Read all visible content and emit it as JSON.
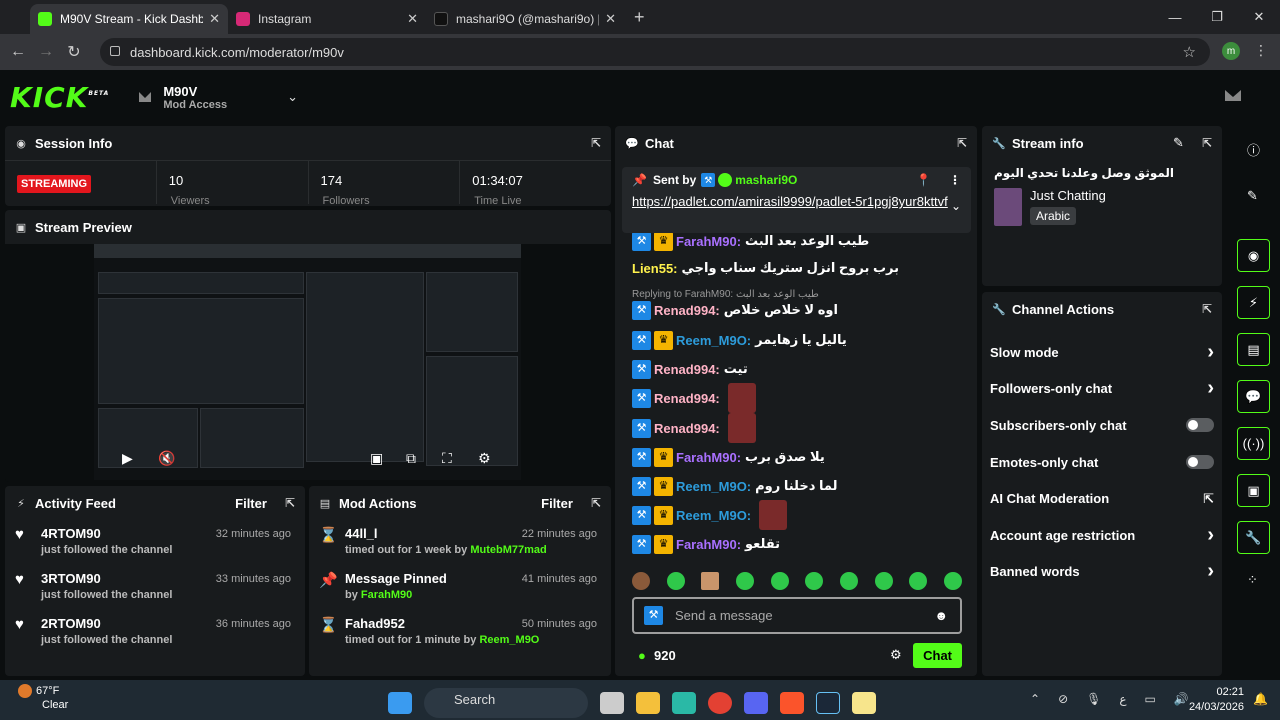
{
  "browser": {
    "tabs": [
      {
        "title": "M90V Stream - Kick Dashboard",
        "color": "#53fc18"
      },
      {
        "title": "Instagram",
        "color": "#d62976"
      },
      {
        "title": "mashari9O (@mashari9o) | TikT",
        "color": "#000000"
      }
    ],
    "url": "dashboard.kick.com/moderator/m90v",
    "profile_initial": "m"
  },
  "header": {
    "logo": "KICK",
    "beta": "BETA",
    "channel_name": "M90V",
    "channel_role": "Mod Access"
  },
  "session": {
    "title": "Session Info",
    "status": "STREAMING",
    "viewers": "10",
    "viewers_label": "Viewers",
    "followers": "174",
    "followers_label": "Followers",
    "time": "01:34:07",
    "time_label": "Time Live"
  },
  "preview": {
    "title": "Stream Preview"
  },
  "activity": {
    "title": "Activity Feed",
    "filter": "Filter",
    "items": [
      {
        "name": "4RTOM90",
        "sub": "just followed the channel",
        "time": "32 minutes ago"
      },
      {
        "name": "3RTOM90",
        "sub": "just followed the channel",
        "time": "33 minutes ago"
      },
      {
        "name": "2RTOM90",
        "sub": "just followed the channel",
        "time": "36 minutes ago"
      }
    ]
  },
  "modactions": {
    "title": "Mod Actions",
    "filter": "Filter",
    "items": [
      {
        "name": "44ll_l",
        "sub": "timed out for 1 week by ",
        "by": "MutebM77mad",
        "time": "22 minutes ago",
        "icon": "hourglass"
      },
      {
        "name": "Message Pinned",
        "sub": "by ",
        "by": "FarahM90",
        "time": "41 minutes ago",
        "icon": "pin"
      },
      {
        "name": "Fahad952",
        "sub": "timed out for 1 minute by ",
        "by": "Reem_M9O",
        "time": "50 minutes ago",
        "icon": "hourglass"
      }
    ]
  },
  "chat": {
    "title": "Chat",
    "pinned_by_label": "Sent by",
    "pinned_by": "mashari9O",
    "pinned_link": "https://padlet.com/amirasil9999/padlet-5r1pgj8yur8kttvf",
    "reply_label": "Replying to FarahM90: طيب الوعد بعد البث",
    "messages": [
      {
        "user": "FarahM90:",
        "color": "#a970ff",
        "text": "طيب الوعد بعد البث",
        "mod": true,
        "crown": true
      },
      {
        "user": "Lien55:",
        "color": "#fff24d",
        "text": "برب بروح انزل ستريك سناب واجي",
        "mod": false,
        "crown": false
      },
      {
        "user": "Renad994:",
        "color": "#ffb3c6",
        "text": "اوه لا خلاص خلاص",
        "mod": true,
        "crown": false
      },
      {
        "user": "Reem_M9O:",
        "color": "#2d9cdb",
        "text": "ياليل يا زهايمر",
        "mod": true,
        "crown": true
      },
      {
        "user": "Renad994:",
        "color": "#ffb3c6",
        "text": "تيت",
        "mod": true,
        "crown": false
      },
      {
        "user": "Renad994:",
        "color": "#ffb3c6",
        "text": "",
        "mod": true,
        "crown": false
      },
      {
        "user": "Renad994:",
        "color": "#ffb3c6",
        "text": "",
        "mod": true,
        "crown": false
      },
      {
        "user": "FarahM90:",
        "color": "#a970ff",
        "text": "يلا صدق برب",
        "mod": true,
        "crown": true
      },
      {
        "user": "Reem_M9O:",
        "color": "#2d9cdb",
        "text": "لما دخلنا روم",
        "mod": true,
        "crown": true
      },
      {
        "user": "Reem_M9O:",
        "color": "#2d9cdb",
        "text": "",
        "mod": true,
        "crown": true
      },
      {
        "user": "FarahM90:",
        "color": "#a970ff",
        "text": "تقلعو",
        "mod": true,
        "crown": true
      }
    ],
    "input_placeholder": "Send a message",
    "points": "920",
    "send": "Chat"
  },
  "streaminfo": {
    "title": "Stream info",
    "stream_title": "الموثق وصل وعلدنا تحدي اليوم",
    "category": "Just Chatting",
    "language": "Arabic"
  },
  "channelactions": {
    "title": "Channel Actions",
    "items": [
      {
        "label": "Slow mode",
        "control": "chevron"
      },
      {
        "label": "Followers-only chat",
        "control": "chevron"
      },
      {
        "label": "Subscribers-only chat",
        "control": "toggle"
      },
      {
        "label": "Emotes-only chat",
        "control": "toggle"
      },
      {
        "label": "AI Chat Moderation",
        "control": "external"
      },
      {
        "label": "Account age restriction",
        "control": "chevron"
      },
      {
        "label": "Banned words",
        "control": "chevron"
      }
    ]
  },
  "taskbar": {
    "temp": "67°F",
    "weather": "Clear",
    "search": "Search",
    "time": "02:21",
    "date": "24/03/2026",
    "lang": "ع"
  }
}
